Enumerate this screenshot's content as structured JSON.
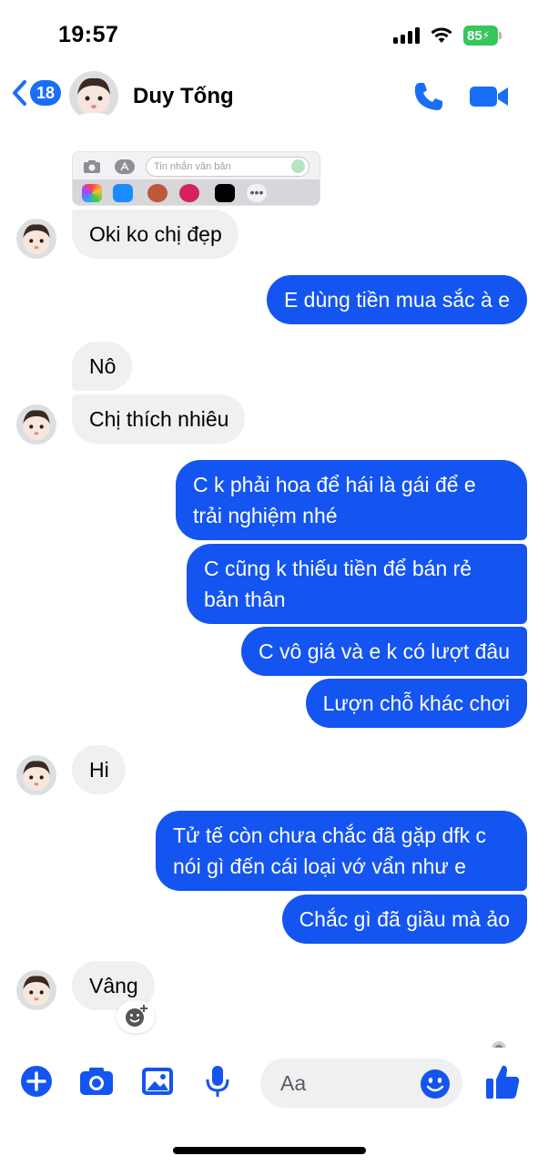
{
  "status_bar": {
    "time": "19:57",
    "battery": "85"
  },
  "header": {
    "back_count": "18",
    "contact_name": "Duy Tống",
    "accent": "#1a6ef5"
  },
  "keyboard_strip": {
    "placeholder": "Tin nhắn văn bản",
    "apps": [
      "photos-app-icon",
      "app-store-icon",
      "memoji-icon",
      "heart-app-icon",
      "tiktok-icon",
      "more-icon"
    ]
  },
  "messages": [
    {
      "side": "in",
      "text": "Oki ko chị đẹp"
    },
    {
      "side": "out",
      "text": "E dùng tiền mua sắc à e"
    },
    {
      "side": "in",
      "text": "Nô"
    },
    {
      "side": "in",
      "text": "Chị thích nhiêu"
    },
    {
      "side": "out",
      "text": "C k phải hoa để hái là gái để e trải nghiệm nhé"
    },
    {
      "side": "out",
      "text": "C cũng k thiếu tiền để bán rẻ bản thân"
    },
    {
      "side": "out",
      "text": "C vô giá và e k có lượt đâu"
    },
    {
      "side": "out",
      "text": "Lượn chỗ khác chơi"
    },
    {
      "side": "in",
      "text": "Hi"
    },
    {
      "side": "out",
      "text": "Tử tế còn chưa chắc đã gặp dfk c nói gì đến cái loại vớ vẩn như e"
    },
    {
      "side": "out",
      "text": "Chắc gì đã giầu mà ảo"
    },
    {
      "side": "in",
      "text": "Vâng"
    }
  ],
  "composer": {
    "placeholder": "Aa"
  },
  "colors": {
    "outgoing_bubble": "#1454f0",
    "incoming_bubble": "#f0f0f2"
  }
}
